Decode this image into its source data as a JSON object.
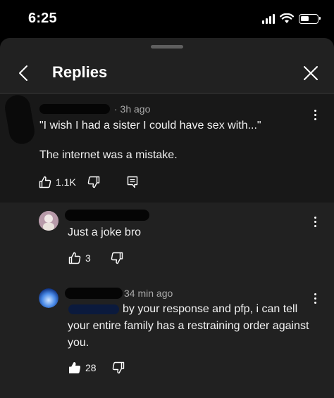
{
  "status": {
    "time": "6:25"
  },
  "header": {
    "title": "Replies"
  },
  "parent_comment": {
    "timestamp": "· 3h ago",
    "lines": [
      "\"I wish I had a sister I could have sex with...\"",
      "The internet was a mistake."
    ],
    "likes": "1.1K"
  },
  "replies": [
    {
      "text": "Just a joke bro",
      "likes": "3"
    },
    {
      "timestamp": "34 min ago",
      "text": "by your response and pfp, i can tell your entire family has a restraining order against you.",
      "likes": "28"
    }
  ]
}
